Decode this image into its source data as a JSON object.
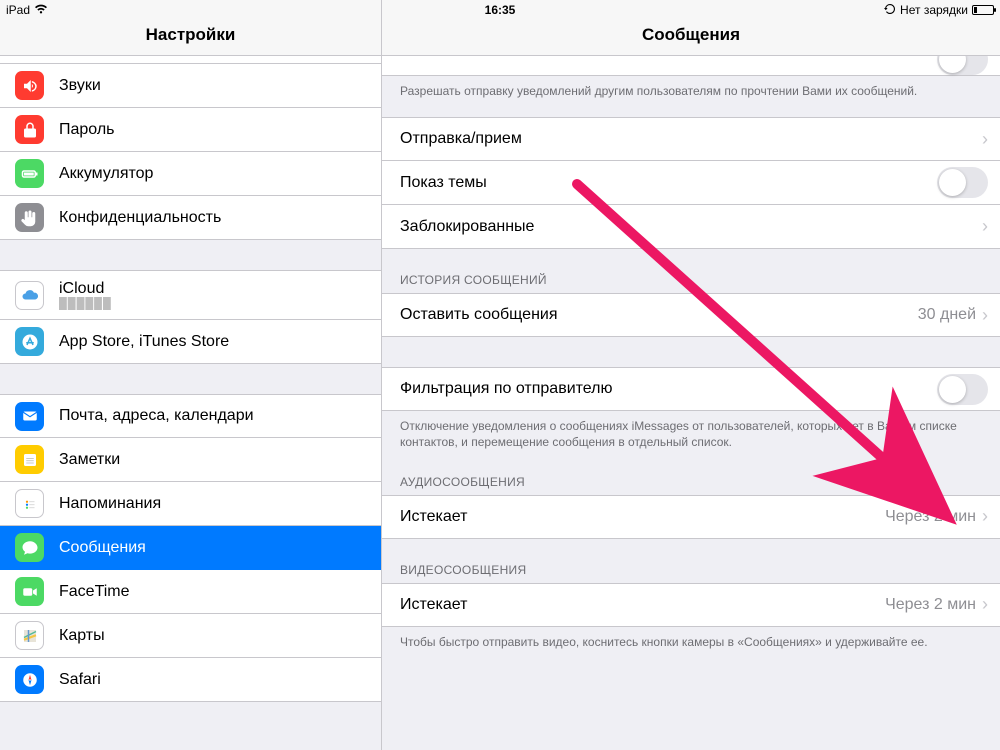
{
  "statusbar": {
    "device": "iPad",
    "time": "16:35",
    "charging_text": "Нет зарядки"
  },
  "sidebar": {
    "title": "Настройки",
    "groups": [
      {
        "items": [
          {
            "id": "sounds",
            "label": "Звуки",
            "icon": "speaker",
            "color": "ic-red"
          },
          {
            "id": "passcode",
            "label": "Пароль",
            "icon": "lock",
            "color": "ic-red"
          },
          {
            "id": "battery",
            "label": "Аккумулятор",
            "icon": "battery",
            "color": "ic-green"
          },
          {
            "id": "privacy",
            "label": "Конфиденциальность",
            "icon": "hand",
            "color": "ic-gray"
          }
        ]
      },
      {
        "items": [
          {
            "id": "icloud",
            "label": "iCloud",
            "sublabel": "",
            "icon": "cloud",
            "color": "ic-white",
            "icloud": true
          },
          {
            "id": "stores",
            "label": "App Store, iTunes Store",
            "icon": "appstore",
            "color": "ic-blueB"
          }
        ]
      },
      {
        "items": [
          {
            "id": "mail",
            "label": "Почта, адреса, календари",
            "icon": "mail",
            "color": "ic-blueA"
          },
          {
            "id": "notes",
            "label": "Заметки",
            "icon": "notes",
            "color": "ic-yellow"
          },
          {
            "id": "reminders",
            "label": "Напоминания",
            "icon": "reminders",
            "color": "ic-white"
          },
          {
            "id": "messages",
            "label": "Сообщения",
            "icon": "bubble",
            "color": "ic-green",
            "selected": true
          },
          {
            "id": "facetime",
            "label": "FaceTime",
            "icon": "video",
            "color": "ic-green"
          },
          {
            "id": "maps",
            "label": "Карты",
            "icon": "map",
            "color": "ic-white"
          },
          {
            "id": "safari",
            "label": "Safari",
            "icon": "compass",
            "color": "ic-blueA"
          }
        ]
      }
    ]
  },
  "detail": {
    "title": "Сообщения",
    "partial_toggle_on": false,
    "read_receipts_footer": "Разрешать отправку уведомлений другим пользователям по прочтении Вами их сообщений.",
    "rows1": [
      {
        "id": "sendreceive",
        "label": "Отправка/прием",
        "value": "",
        "chev": true
      },
      {
        "id": "subject",
        "label": "Показ темы",
        "toggle": true,
        "on": false
      },
      {
        "id": "blocked",
        "label": "Заблокированные",
        "chev": true
      }
    ],
    "history_header": "ИСТОРИЯ СООБЩЕНИЙ",
    "history_row": {
      "label": "Оставить сообщения",
      "value": "30 дней"
    },
    "filter_row": {
      "label": "Фильтрация по отправителю",
      "on": false
    },
    "filter_footer": "Отключение уведомления о сообщениях iMessages от пользователей, которых нет в Вашем списке контактов, и перемещение сообщения  в отдельный список.",
    "audio_header": "АУДИОСООБЩЕНИЯ",
    "audio_row": {
      "label": "Истекает",
      "value": "Через 2 мин"
    },
    "video_header": "ВИДЕОСООБЩЕНИЯ",
    "video_row": {
      "label": "Истекает",
      "value": "Через 2 мин"
    },
    "video_footer": "Чтобы быстро отправить видео, коснитесь кнопки камеры в «Сообщениях» и удерживайте ее."
  },
  "arrow": {
    "color": "#ec1763"
  }
}
